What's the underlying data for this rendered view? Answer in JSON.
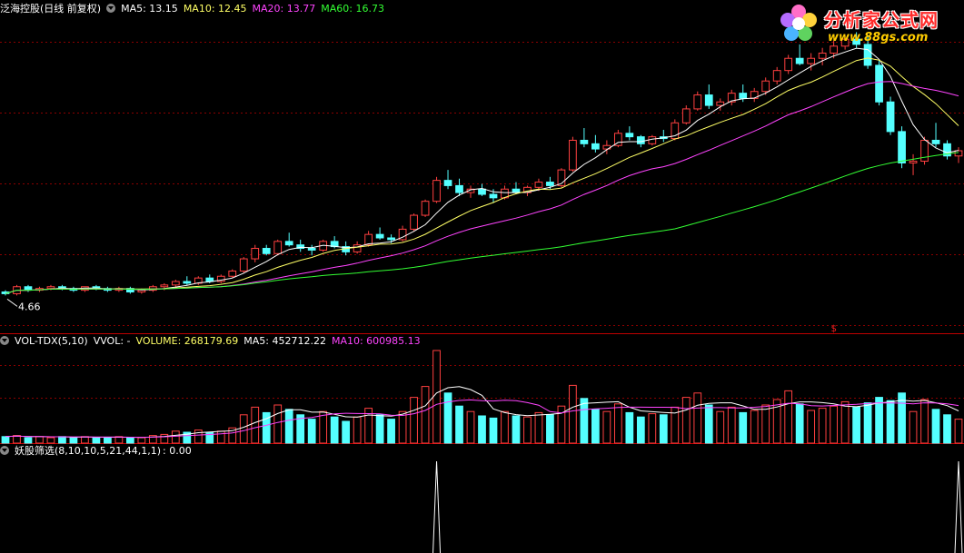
{
  "price_panel": {
    "stock_name": "泛海控股(日线 前复权)",
    "ma5": "MA5: 13.15",
    "ma10": "MA10: 12.45",
    "ma20": "MA20: 13.77",
    "ma60": "MA60: 16.73",
    "low_label": "4.66",
    "signal_marker": "$"
  },
  "volume_panel": {
    "indicator": "VOL-TDX(5,10)",
    "vvol": "VVOL: -",
    "volume": "VOLUME: 268179.69",
    "ma5": "MA5: 452712.22",
    "ma10": "MA10: 600985.13"
  },
  "signal_panel": {
    "indicator": "妖股筛选(8,10,10,5,21,44,1,1)",
    "value": ": 0.00"
  },
  "watermark": {
    "name": "分析家公式网",
    "url": "www.88gs.com"
  },
  "colors": {
    "background": "#000000",
    "up": "#ff4040",
    "down": "#54ffff",
    "grid": "#8b0000",
    "ma5": "#ffffff",
    "ma10": "#ffff66",
    "ma20": "#ff44ff",
    "ma60": "#33ff33",
    "label": "#ffffff"
  },
  "chart_data": [
    {
      "type": "candlestick",
      "title": "泛海控股(日线 前复权)",
      "ylim": [
        3.0,
        20.5
      ],
      "min_price_label": 4.66,
      "candles": [
        [
          4.9,
          5.0,
          4.7,
          4.8
        ],
        [
          4.8,
          5.3,
          4.7,
          5.2
        ],
        [
          5.2,
          5.3,
          4.9,
          5.0
        ],
        [
          5.0,
          5.2,
          4.9,
          5.1
        ],
        [
          5.1,
          5.3,
          5.0,
          5.2
        ],
        [
          5.2,
          5.3,
          5.0,
          5.1
        ],
        [
          5.1,
          5.2,
          4.9,
          5.0
        ],
        [
          5.0,
          5.2,
          4.9,
          5.2
        ],
        [
          5.2,
          5.3,
          5.0,
          5.1
        ],
        [
          5.1,
          5.2,
          4.9,
          5.0
        ],
        [
          5.0,
          5.2,
          4.9,
          5.1
        ],
        [
          5.1,
          5.2,
          4.8,
          4.9
        ],
        [
          4.9,
          5.1,
          4.8,
          5.0
        ],
        [
          5.0,
          5.3,
          4.9,
          5.2
        ],
        [
          5.2,
          5.4,
          5.0,
          5.3
        ],
        [
          5.3,
          5.6,
          5.1,
          5.5
        ],
        [
          5.5,
          5.8,
          5.3,
          5.4
        ],
        [
          5.4,
          5.8,
          5.3,
          5.7
        ],
        [
          5.7,
          5.9,
          5.4,
          5.5
        ],
        [
          5.5,
          5.9,
          5.4,
          5.8
        ],
        [
          5.8,
          6.2,
          5.7,
          6.1
        ],
        [
          6.1,
          6.9,
          6.0,
          6.8
        ],
        [
          6.8,
          7.6,
          6.6,
          7.4
        ],
        [
          7.4,
          7.6,
          7.0,
          7.1
        ],
        [
          7.1,
          7.9,
          7.0,
          7.8
        ],
        [
          7.8,
          8.3,
          7.5,
          7.6
        ],
        [
          7.6,
          7.9,
          7.2,
          7.4
        ],
        [
          7.4,
          7.6,
          7.0,
          7.3
        ],
        [
          7.3,
          7.9,
          7.2,
          7.8
        ],
        [
          7.8,
          8.1,
          7.4,
          7.5
        ],
        [
          7.5,
          7.8,
          7.0,
          7.2
        ],
        [
          7.2,
          7.8,
          7.1,
          7.6
        ],
        [
          7.6,
          8.4,
          7.5,
          8.2
        ],
        [
          8.2,
          8.6,
          7.9,
          8.0
        ],
        [
          8.0,
          8.2,
          7.7,
          7.9
        ],
        [
          7.9,
          8.7,
          7.8,
          8.5
        ],
        [
          8.5,
          9.4,
          8.4,
          9.3
        ],
        [
          9.3,
          10.2,
          9.2,
          10.1
        ],
        [
          10.1,
          11.5,
          10.0,
          11.3
        ],
        [
          11.3,
          11.9,
          10.8,
          11.0
        ],
        [
          11.0,
          11.4,
          10.4,
          10.6
        ],
        [
          10.6,
          11.0,
          10.3,
          10.8
        ],
        [
          10.8,
          11.1,
          10.4,
          10.5
        ],
        [
          10.5,
          10.8,
          10.0,
          10.3
        ],
        [
          10.3,
          11.0,
          10.2,
          10.8
        ],
        [
          10.8,
          11.2,
          10.5,
          10.6
        ],
        [
          10.6,
          11.0,
          10.4,
          10.9
        ],
        [
          10.9,
          11.4,
          10.7,
          11.2
        ],
        [
          11.2,
          11.5,
          10.8,
          11.0
        ],
        [
          11.0,
          12.0,
          10.9,
          11.9
        ],
        [
          11.9,
          13.8,
          11.8,
          13.6
        ],
        [
          13.6,
          14.3,
          13.2,
          13.4
        ],
        [
          13.4,
          13.9,
          12.9,
          13.1
        ],
        [
          13.1,
          13.6,
          12.8,
          13.3
        ],
        [
          13.3,
          14.2,
          13.2,
          14.0
        ],
        [
          14.0,
          14.4,
          13.6,
          13.8
        ],
        [
          13.8,
          13.9,
          13.2,
          13.4
        ],
        [
          13.4,
          13.9,
          13.3,
          13.8
        ],
        [
          13.8,
          14.2,
          13.5,
          13.7
        ],
        [
          13.7,
          14.8,
          13.6,
          14.6
        ],
        [
          14.6,
          15.6,
          14.5,
          15.4
        ],
        [
          15.4,
          16.4,
          15.3,
          16.2
        ],
        [
          16.2,
          16.8,
          15.4,
          15.6
        ],
        [
          15.6,
          16.0,
          15.3,
          15.8
        ],
        [
          15.8,
          16.5,
          15.6,
          16.3
        ],
        [
          16.3,
          16.8,
          15.8,
          16.0
        ],
        [
          16.0,
          16.6,
          15.8,
          16.4
        ],
        [
          16.4,
          17.2,
          16.2,
          17.0
        ],
        [
          17.0,
          17.8,
          16.8,
          17.6
        ],
        [
          17.6,
          18.5,
          17.4,
          18.3
        ],
        [
          18.3,
          19.1,
          17.9,
          18.0
        ],
        [
          18.0,
          18.6,
          17.6,
          18.3
        ],
        [
          18.3,
          18.9,
          17.9,
          18.6
        ],
        [
          18.6,
          19.3,
          18.3,
          19.0
        ],
        [
          19.0,
          19.6,
          18.8,
          19.4
        ],
        [
          19.4,
          19.8,
          18.9,
          19.1
        ],
        [
          19.1,
          19.6,
          17.7,
          17.9
        ],
        [
          17.9,
          18.2,
          15.6,
          15.8
        ],
        [
          15.8,
          16.1,
          13.9,
          14.1
        ],
        [
          14.1,
          14.4,
          12.0,
          12.3
        ],
        [
          12.3,
          12.8,
          11.6,
          12.4
        ],
        [
          12.4,
          13.8,
          12.2,
          13.6
        ],
        [
          13.6,
          14.6,
          13.2,
          13.4
        ],
        [
          13.4,
          13.6,
          12.5,
          12.7
        ],
        [
          12.7,
          13.2,
          12.3,
          13.0
        ]
      ],
      "moving_averages": [
        {
          "name": "MA5",
          "value": 13.15
        },
        {
          "name": "MA10",
          "value": 12.45
        },
        {
          "name": "MA20",
          "value": 13.77
        },
        {
          "name": "MA60",
          "value": 16.73
        }
      ]
    },
    {
      "type": "bar",
      "title": "VOL-TDX(5,10)",
      "volume_last": 268179.69,
      "ma5_last": 452712.22,
      "ma10_last": 600985.13,
      "volumes": [
        0.6,
        0.7,
        0.5,
        0.6,
        0.5,
        0.6,
        0.5,
        0.6,
        0.5,
        0.5,
        0.6,
        0.5,
        0.5,
        0.7,
        0.8,
        1.1,
        1.0,
        1.2,
        1.0,
        1.1,
        1.4,
        2.6,
        3.3,
        2.8,
        3.5,
        3.1,
        2.6,
        2.2,
        2.9,
        2.4,
        2.0,
        2.4,
        3.2,
        2.6,
        2.2,
        2.9,
        4.2,
        5.2,
        8.5,
        4.6,
        3.4,
        2.9,
        2.5,
        2.3,
        2.9,
        2.5,
        2.4,
        2.8,
        2.6,
        3.4,
        5.3,
        4.1,
        3.1,
        2.9,
        3.6,
        2.8,
        2.4,
        2.7,
        2.6,
        3.3,
        4.2,
        4.6,
        3.5,
        2.9,
        3.3,
        2.8,
        3.0,
        3.5,
        4.0,
        4.8,
        3.6,
        3.0,
        3.2,
        3.4,
        3.8,
        3.3,
        3.7,
        4.2,
        3.9,
        4.6,
        2.9,
        4.0,
        3.1,
        2.6,
        2.2
      ]
    },
    {
      "type": "line",
      "title": "妖股筛选(8,10,10,5,21,44,1,1)",
      "ylim": [
        0,
        1
      ],
      "signal_days": [
        38,
        84
      ]
    }
  ]
}
